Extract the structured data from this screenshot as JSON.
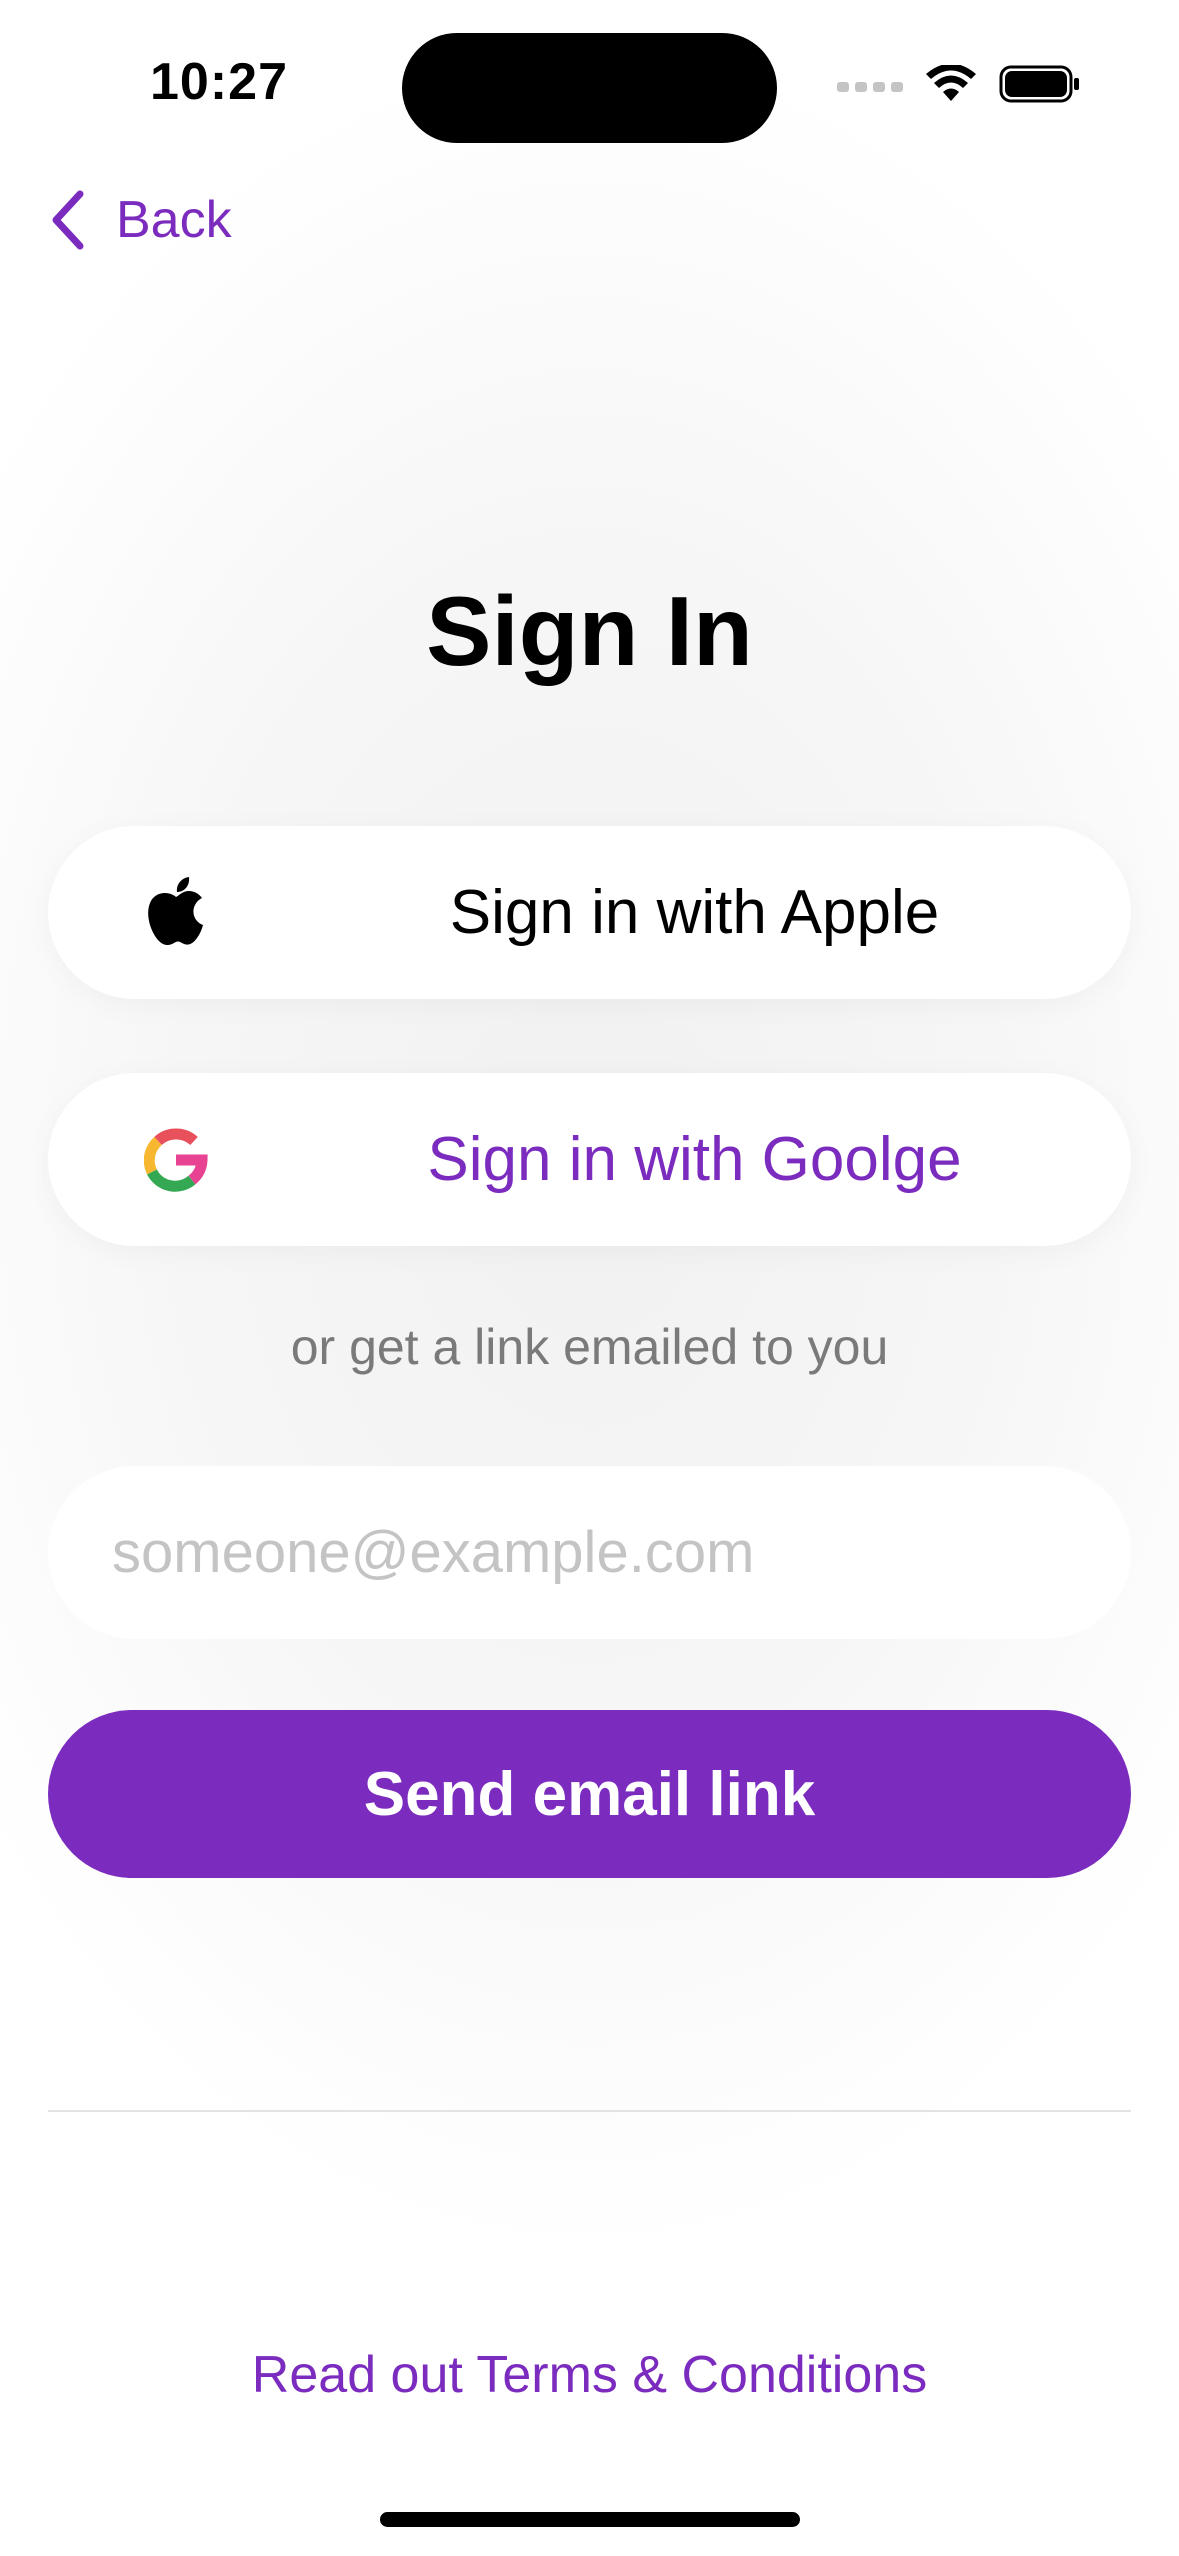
{
  "status_bar": {
    "time": "10:27"
  },
  "nav": {
    "back_label": "Back"
  },
  "title": "Sign In",
  "apple_button": {
    "label": "Sign in with Apple",
    "icon": "apple-icon"
  },
  "google_button": {
    "label": "Sign in with Goolge",
    "icon": "google-icon"
  },
  "or_text": "or get a link emailed to you",
  "email_field": {
    "placeholder": "someone@example.com",
    "value": ""
  },
  "send_button": {
    "label": "Send email link"
  },
  "terms_link": "Read out Terms & Conditions",
  "colors": {
    "accent": "#7b2cbf",
    "muted_text": "#7a7a7a",
    "placeholder": "#c4c4c4"
  }
}
